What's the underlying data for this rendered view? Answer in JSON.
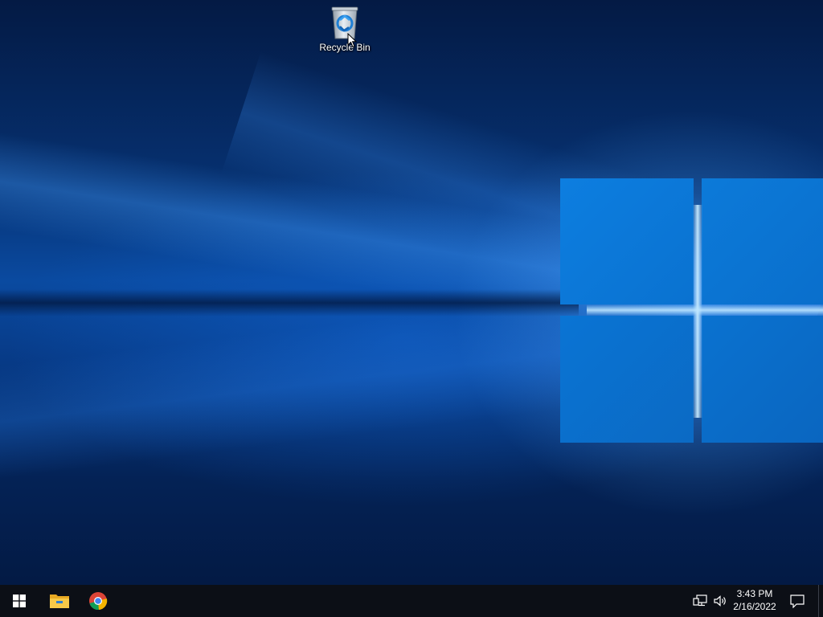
{
  "desktop": {
    "icons": [
      {
        "label": "Recycle Bin",
        "icon": "recycle-bin-icon"
      }
    ],
    "wallpaper": "windows-10-hero",
    "colors": {
      "accent": "#0a78d8",
      "background": "#031a3f"
    }
  },
  "taskbar": {
    "start_icon": "windows-logo-icon",
    "pinned": [
      {
        "name": "File Explorer",
        "icon": "folder-icon"
      },
      {
        "name": "Google Chrome",
        "icon": "chrome-icon"
      }
    ],
    "tray": {
      "network_icon": "network-icon",
      "volume_icon": "volume-icon",
      "notification_icon": "notification-icon"
    },
    "clock": {
      "time": "3:43 PM",
      "date": "2/16/2022"
    },
    "colors": {
      "background": "#0c0f16"
    }
  }
}
